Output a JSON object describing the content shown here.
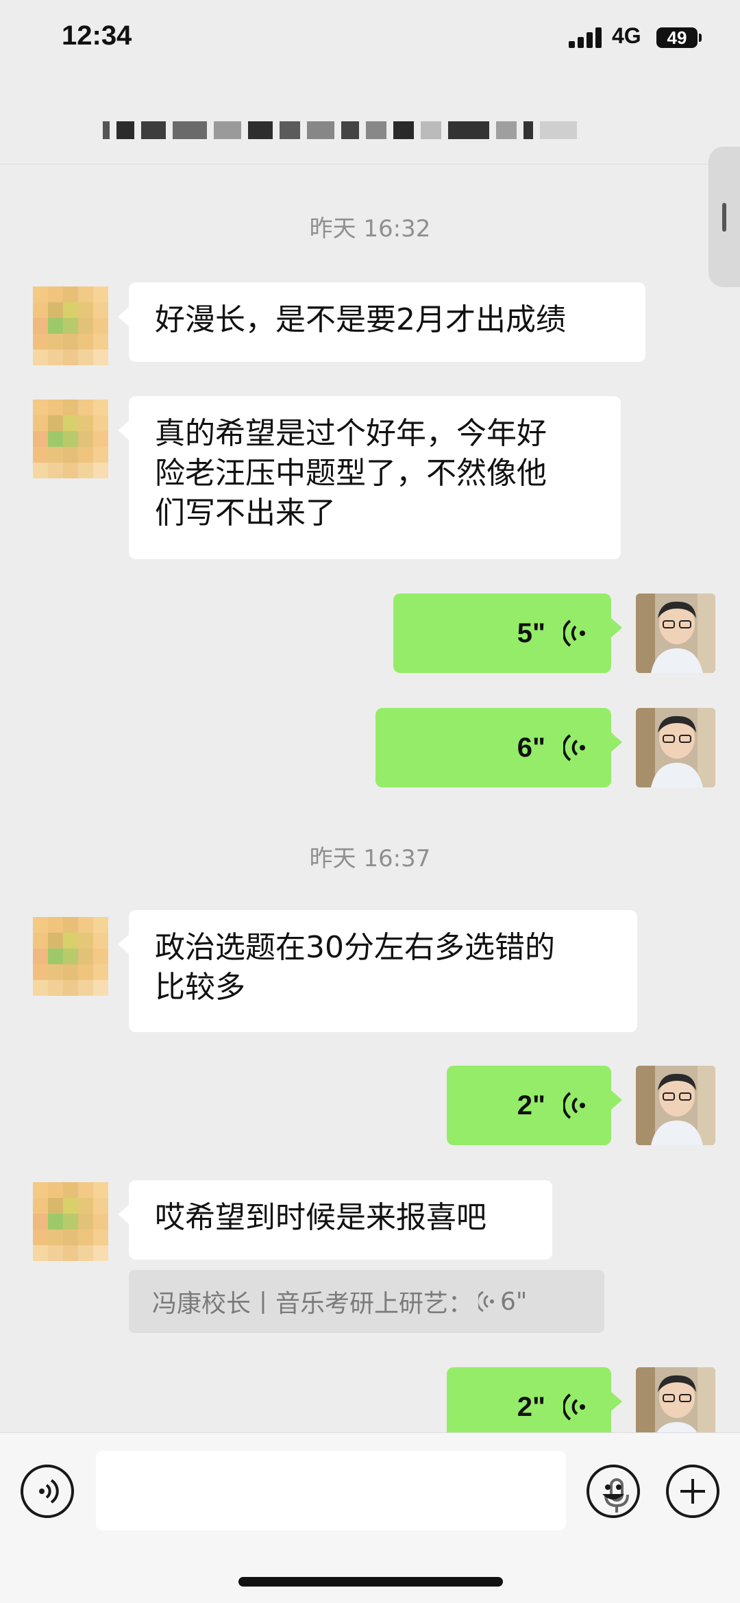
{
  "status_bar": {
    "time": "12:34",
    "network": "4G",
    "battery": "49"
  },
  "messages": [
    {
      "type": "timestamp",
      "text": "昨天 16:32"
    },
    {
      "type": "text",
      "side": "left",
      "lines": [
        "好漫长，是不是要2月才出成绩"
      ]
    },
    {
      "type": "text",
      "side": "left",
      "lines": [
        "真的希望是过个好年，今年好",
        "险老汪压中题型了，不然像他",
        "们写不出来了"
      ]
    },
    {
      "type": "voice",
      "side": "right",
      "duration": "5\""
    },
    {
      "type": "voice",
      "side": "right",
      "duration": "6\""
    },
    {
      "type": "timestamp",
      "text": "昨天 16:37"
    },
    {
      "type": "text",
      "side": "left",
      "lines": [
        "政治选题在30分左右多选错的",
        "比较多"
      ]
    },
    {
      "type": "voice",
      "side": "right",
      "duration": "2\""
    },
    {
      "type": "text",
      "side": "left",
      "lines": [
        "哎希望到时候是来报喜吧"
      ]
    },
    {
      "type": "quote",
      "text": "冯康校长丨音乐考研上研艺：",
      "duration": "6\""
    },
    {
      "type": "voice",
      "side": "right",
      "duration": "2\""
    }
  ],
  "icons": {
    "voice_mode": "voice-mode-icon",
    "mic": "microphone-icon",
    "emoji": "emoji-icon",
    "plus": "plus-icon",
    "voice_wave": "voice-wave-icon"
  },
  "colors": {
    "background": "#ededed",
    "sent_bubble": "#95ec69",
    "received_bubble": "#ffffff"
  }
}
